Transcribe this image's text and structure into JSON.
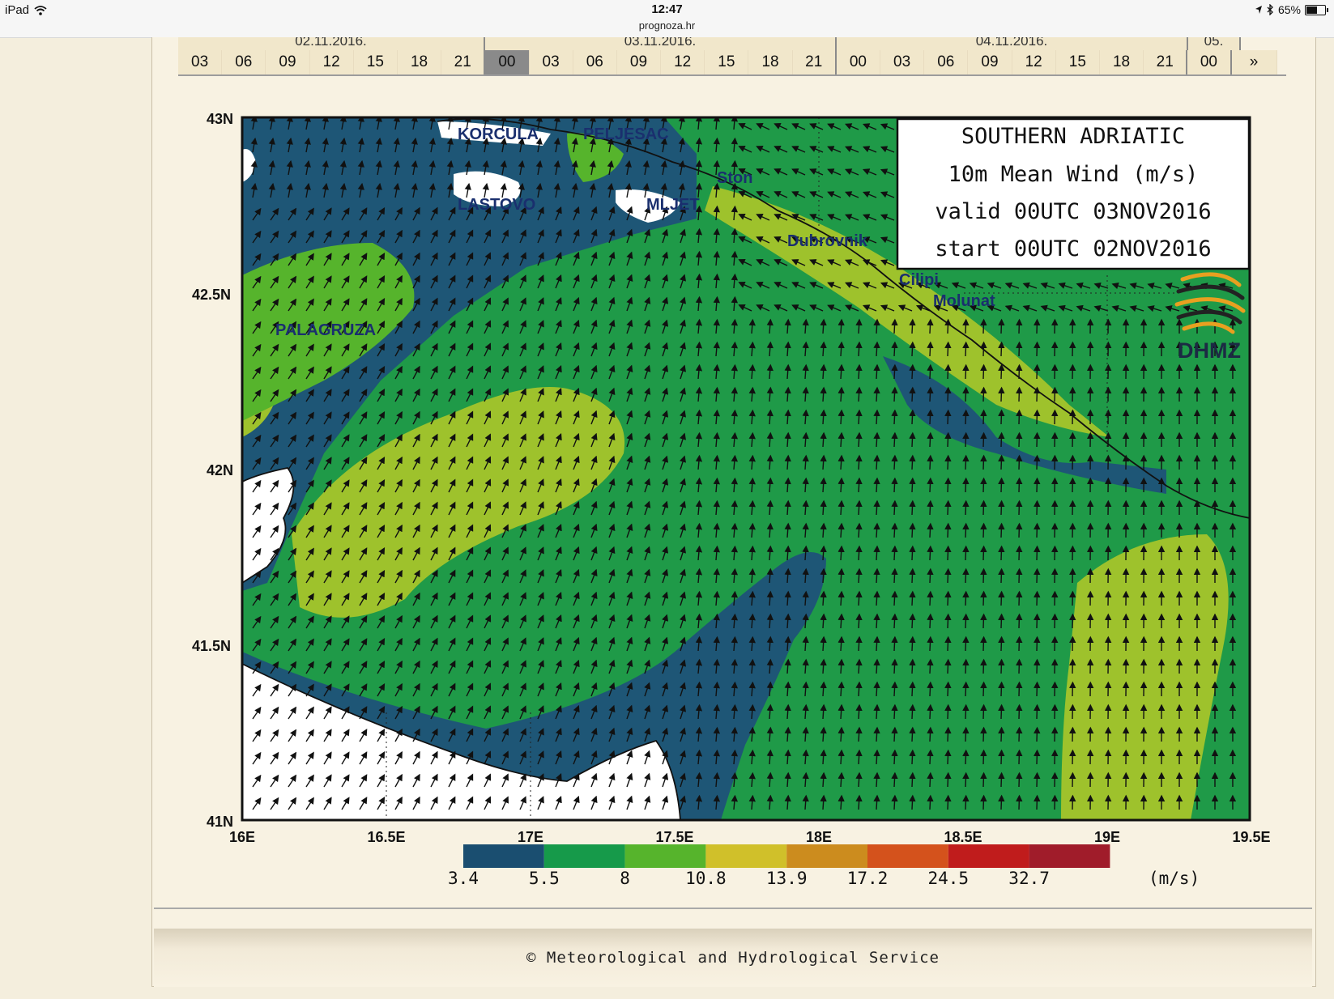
{
  "status_bar": {
    "device": "iPad",
    "time": "12:47",
    "url": "prognoza.hr",
    "battery": "65%",
    "battery_level": 0.65
  },
  "dates": [
    "02.11.2016.",
    "03.11.2016.",
    "04.11.2016.",
    "05."
  ],
  "hours": {
    "d1": [
      "03",
      "06",
      "09",
      "12",
      "15",
      "18",
      "21"
    ],
    "d2": [
      "00",
      "03",
      "06",
      "09",
      "12",
      "15",
      "18",
      "21"
    ],
    "d3": [
      "00",
      "03",
      "06",
      "09",
      "12",
      "15",
      "18",
      "21"
    ],
    "d4": [
      "00"
    ],
    "next": "»",
    "selected": "03.11.2016. 00"
  },
  "map": {
    "title_lines": [
      "SOUTHERN ADRIATIC",
      "10m Mean Wind (m/s)",
      "valid 00UTC 03NOV2016",
      "start 00UTC 02NOV2016"
    ],
    "logo_text": "DHMZ",
    "lat_labels": [
      "43N",
      "42.5N",
      "42N",
      "41.5N",
      "41N"
    ],
    "lon_labels": [
      "16E",
      "16.5E",
      "17E",
      "17.5E",
      "18E",
      "18.5E",
      "19E",
      "19.5E"
    ],
    "places": [
      "KORCULA",
      "PELJESAC",
      "Ston",
      "LASTOVO",
      "MLJET",
      "Dubrovnik",
      "Cilipi",
      "Molunat",
      "PALAGRUZA"
    ],
    "legend": {
      "values": [
        "3.4",
        "5.5",
        "8",
        "10.8",
        "13.9",
        "17.2",
        "24.5",
        "32.7"
      ],
      "unit": "(m/s)",
      "colors": [
        "#1a4e70",
        "#169a4a",
        "#56b42c",
        "#d0c02a",
        "#cc8c1e",
        "#d4521c",
        "#c01c1c",
        "#a01c2a"
      ]
    },
    "land_color": "#ffffff",
    "sea_base_color": "#1f9a48",
    "low_wind_color": "#1e5676",
    "high_wind_color": "#9ec22c"
  },
  "footer": {
    "copyright": "© Meteorological and Hydrological Service"
  }
}
